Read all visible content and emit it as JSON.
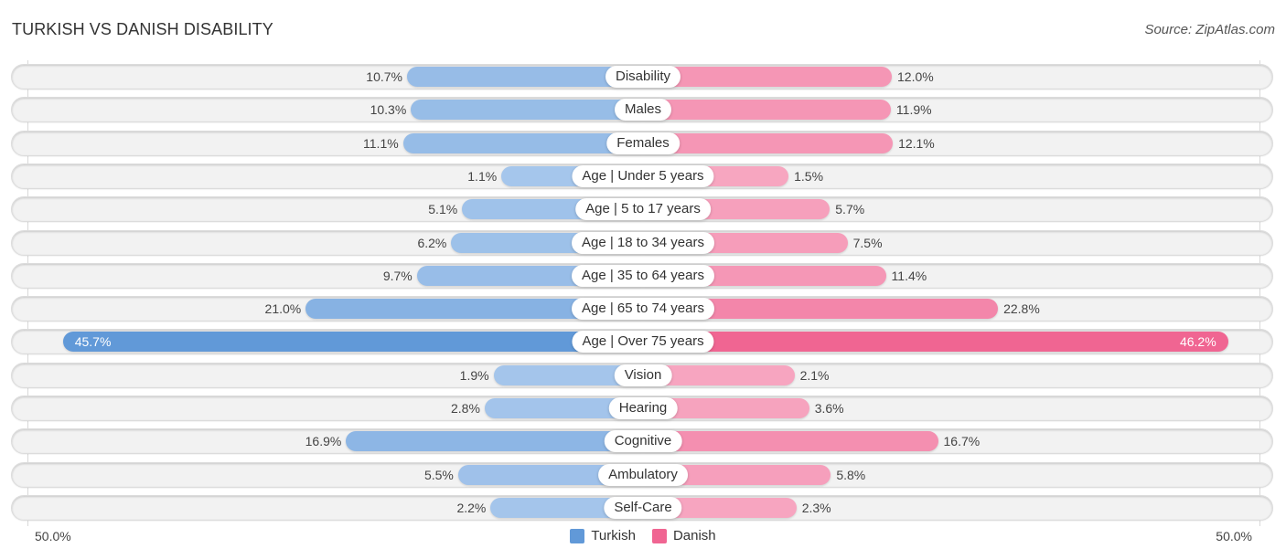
{
  "header": {
    "title": "TURKISH VS DANISH DISABILITY",
    "source": "Source: ZipAtlas.com"
  },
  "colors": {
    "turkish": "#6199d8",
    "turkish_light": "#a7c7ec",
    "danish": "#f06592",
    "danish_light": "#f7a8c2"
  },
  "chart_data": {
    "type": "bar",
    "orientation": "horizontal-diverging",
    "title": "TURKISH VS DANISH DISABILITY",
    "categories": [
      "Disability",
      "Males",
      "Females",
      "Age | Under 5 years",
      "Age | 5 to 17 years",
      "Age | 18 to 34 years",
      "Age | 35 to 64 years",
      "Age | 65 to 74 years",
      "Age | Over 75 years",
      "Vision",
      "Hearing",
      "Cognitive",
      "Ambulatory",
      "Self-Care"
    ],
    "series": [
      {
        "name": "Turkish",
        "side": "left",
        "values": [
          10.7,
          10.3,
          11.1,
          1.1,
          5.1,
          6.2,
          9.7,
          21.0,
          45.7,
          1.9,
          2.8,
          16.9,
          5.5,
          2.2
        ],
        "labels": [
          "10.7%",
          "10.3%",
          "11.1%",
          "1.1%",
          "5.1%",
          "6.2%",
          "9.7%",
          "21.0%",
          "45.7%",
          "1.9%",
          "2.8%",
          "16.9%",
          "5.5%",
          "2.2%"
        ]
      },
      {
        "name": "Danish",
        "side": "right",
        "values": [
          12.0,
          11.9,
          12.1,
          1.5,
          5.7,
          7.5,
          11.4,
          22.8,
          46.2,
          2.1,
          3.6,
          16.7,
          5.8,
          2.3
        ],
        "labels": [
          "12.0%",
          "11.9%",
          "12.1%",
          "1.5%",
          "5.7%",
          "7.5%",
          "11.4%",
          "22.8%",
          "46.2%",
          "2.1%",
          "3.6%",
          "16.7%",
          "5.8%",
          "2.3%"
        ]
      }
    ],
    "axis": {
      "left_label": "50.0%",
      "right_label": "50.0%",
      "range": [
        0,
        50
      ]
    },
    "legend": {
      "placement": "bottom-center",
      "entries": [
        "Turkish",
        "Danish"
      ]
    },
    "highlight_index": 8
  }
}
